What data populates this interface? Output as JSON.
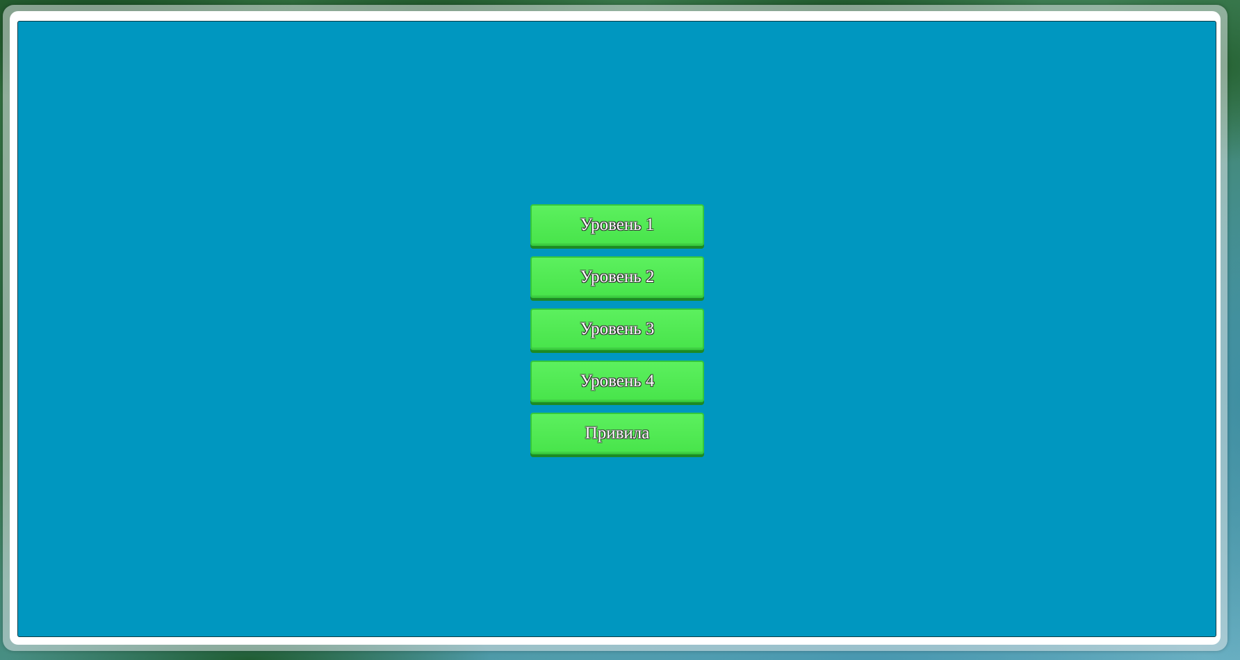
{
  "menu": {
    "items": [
      {
        "label": "Уровень 1"
      },
      {
        "label": "Уровень 2"
      },
      {
        "label": "Уровень 3"
      },
      {
        "label": "Уровень 4"
      },
      {
        "label": "Привила"
      }
    ]
  },
  "colors": {
    "panel_background": "#0097c0",
    "button_green": "#4ae84d",
    "button_shadow": "#1d8a24",
    "frame_white": "#ffffff"
  }
}
